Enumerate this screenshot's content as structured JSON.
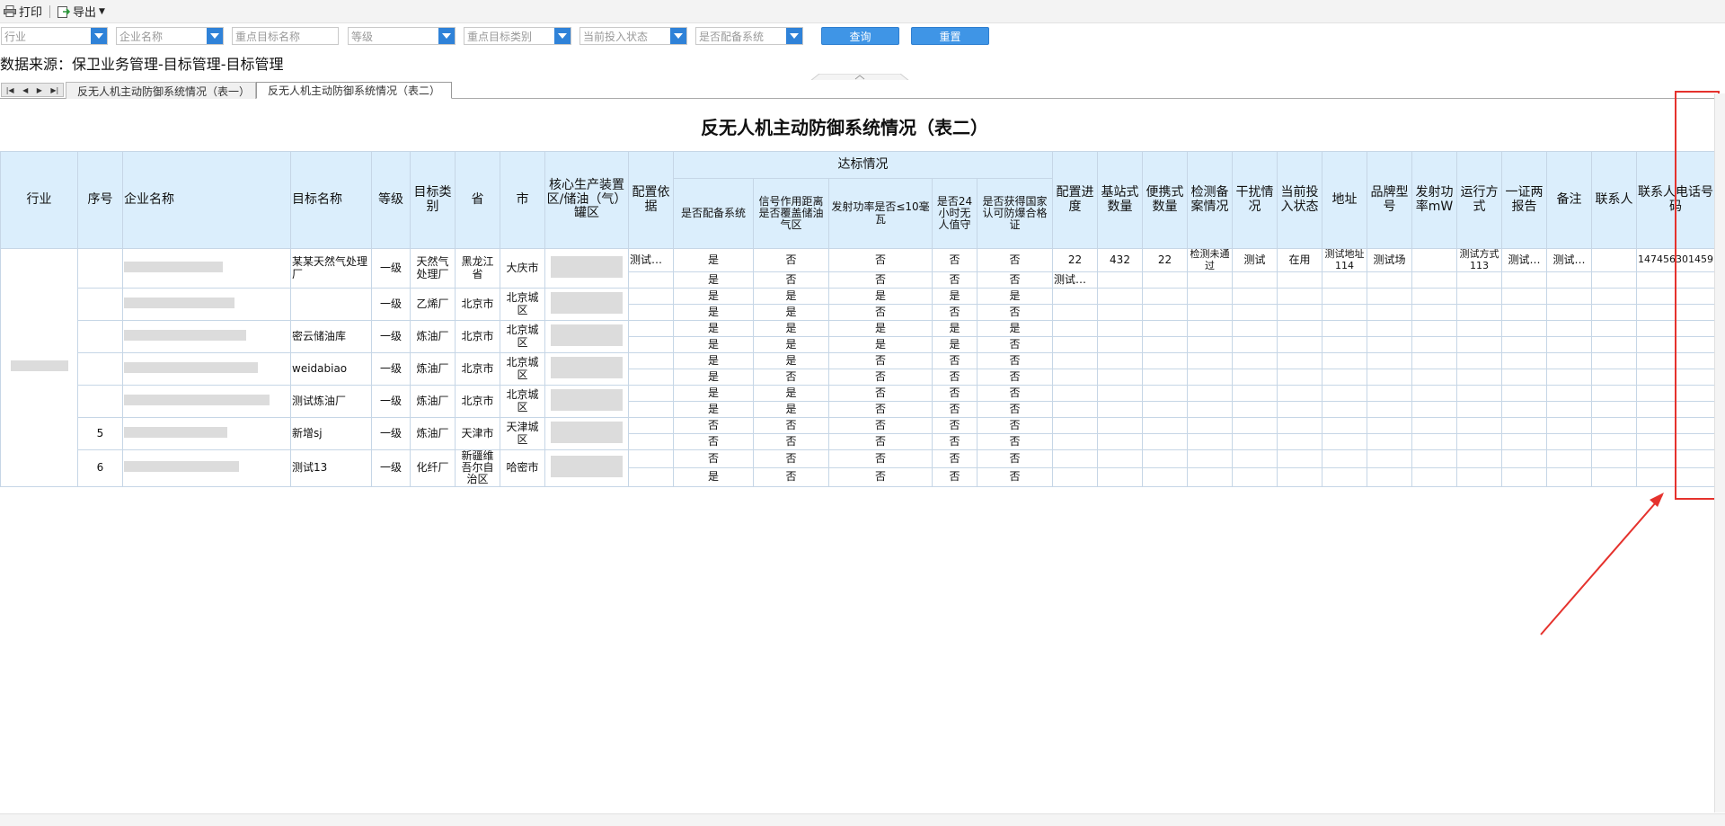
{
  "toolbar": {
    "print": "打印",
    "export": "导出"
  },
  "filters": {
    "industry": "行业",
    "company": "企业名称",
    "target_name": "重点目标名称",
    "level": "等级",
    "target_type": "重点目标类别",
    "status": "当前投入状态",
    "equipped": "是否配备系统",
    "query": "查询",
    "reset": "重置"
  },
  "source_text": "数据来源：保卫业务管理-目标管理-目标管理",
  "tabs": [
    "反无人机主动防御系统情况（表一）",
    "反无人机主动防御系统情况（表二）"
  ],
  "report_title": "反无人机主动防御系统情况（表二）",
  "headers": {
    "industry": "行业",
    "seq": "序号",
    "company": "企业名称",
    "target": "目标名称",
    "level": "等级",
    "type": "目标类别",
    "province": "省",
    "city": "市",
    "core": "核心生产装置区/储油（气）罐区",
    "basis": "配置依据",
    "group": "达标情况",
    "equipped": "是否配备系统",
    "signal": "信号作用距离是否覆盖储油气区",
    "power": "发射功率是否≤10毫瓦",
    "duty": "是否24小时无人值守",
    "cert": "是否获得国家认可防爆合格证",
    "progress": "配置进度",
    "base_qty": "基站式数量",
    "portable_qty": "便携式数量",
    "filing": "检测备案情况",
    "interference": "干扰情况",
    "status": "当前投入状态",
    "address": "地址",
    "brand": "品牌型号",
    "tx_power": "发射功率mW",
    "mode": "运行方式",
    "report": "一证两报告",
    "remark": "备注",
    "contact": "联系人",
    "phone": "联系人电话号码"
  },
  "groups": [
    {
      "seq": "",
      "target": "某某天然气处理厂",
      "level": "一级",
      "type": "天然气处理厂",
      "province": "黑龙江省",
      "city": "大庆市",
      "rows": [
        {
          "basis": "测试…",
          "c": [
            "是",
            "否",
            "否",
            "否",
            "否"
          ],
          "progress": "22",
          "base": "432",
          "portable": "22",
          "filing": "检测未通过",
          "interference": "测试",
          "status": "在用",
          "address": "测试地址114",
          "brand": "测试场",
          "txp": "",
          "mode": "测试方式113",
          "report": "测试…",
          "remark": "测试…",
          "contact": "",
          "phone": "147456301459"
        },
        {
          "basis": "",
          "c": [
            "是",
            "否",
            "否",
            "否",
            "否"
          ],
          "progress": "测试…",
          "base": "",
          "portable": "",
          "filing": "",
          "interference": "",
          "status": "",
          "address": "",
          "brand": "",
          "txp": "",
          "mode": "",
          "report": "",
          "remark": "",
          "contact": "",
          "phone": ""
        }
      ]
    },
    {
      "seq": "",
      "target": "",
      "level": "一级",
      "type": "乙烯厂",
      "province": "北京市",
      "city": "北京城区",
      "rows": [
        {
          "c": [
            "是",
            "是",
            "是",
            "是",
            "是"
          ]
        },
        {
          "c": [
            "是",
            "是",
            "否",
            "否",
            "否"
          ]
        }
      ]
    },
    {
      "seq": "",
      "target": "密云储油库",
      "level": "一级",
      "type": "炼油厂",
      "province": "北京市",
      "city": "北京城区",
      "rows": [
        {
          "c": [
            "是",
            "是",
            "是",
            "是",
            "是"
          ]
        },
        {
          "c": [
            "是",
            "是",
            "是",
            "是",
            "否"
          ]
        }
      ]
    },
    {
      "seq": "",
      "target": "weidabiao",
      "level": "一级",
      "type": "炼油厂",
      "province": "北京市",
      "city": "北京城区",
      "rows": [
        {
          "c": [
            "是",
            "是",
            "否",
            "否",
            "否"
          ]
        },
        {
          "c": [
            "是",
            "否",
            "否",
            "否",
            "否"
          ]
        }
      ]
    },
    {
      "seq": "",
      "target": "测试炼油厂",
      "level": "一级",
      "type": "炼油厂",
      "province": "北京市",
      "city": "北京城区",
      "rows": [
        {
          "c": [
            "是",
            "是",
            "否",
            "否",
            "否"
          ]
        },
        {
          "c": [
            "是",
            "是",
            "否",
            "否",
            "否"
          ]
        }
      ]
    },
    {
      "seq": "5",
      "target": "新增sj",
      "level": "一级",
      "type": "炼油厂",
      "province": "天津市",
      "city": "天津城区",
      "rows": [
        {
          "c": [
            "否",
            "否",
            "否",
            "否",
            "否"
          ]
        },
        {
          "c": [
            "否",
            "否",
            "否",
            "否",
            "否"
          ]
        }
      ]
    },
    {
      "seq": "6",
      "target": "测试13",
      "level": "一级",
      "type": "化纤厂",
      "province": "新疆维吾尔自治区",
      "city": "哈密市",
      "rows": [
        {
          "c": [
            "否",
            "否",
            "否",
            "否",
            "否"
          ]
        },
        {
          "c": [
            "是",
            "否",
            "否",
            "否",
            "否"
          ]
        }
      ]
    }
  ]
}
